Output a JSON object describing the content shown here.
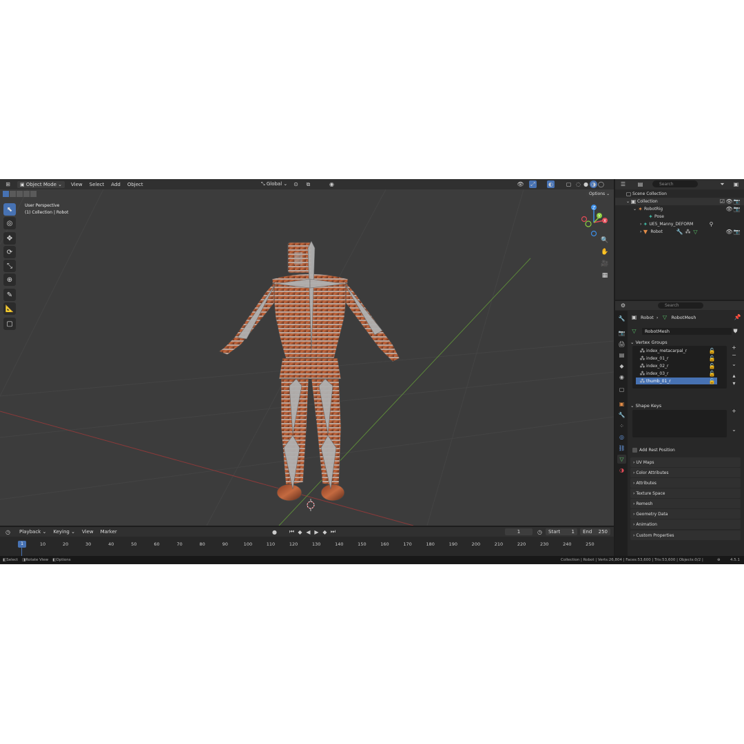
{
  "viewport_header": {
    "mode": "Object Mode",
    "menus": [
      "View",
      "Select",
      "Add",
      "Object"
    ],
    "orientation": "Global",
    "options": "Options"
  },
  "viewport": {
    "perspective": "User Perspective",
    "collection_label": "(1) Collection | Robot",
    "gizmo_axes": [
      "Z",
      "Y",
      "X"
    ]
  },
  "outliner": {
    "search_placeholder": "Search",
    "rows": [
      {
        "label": "Scene Collection"
      },
      {
        "label": "Collection"
      },
      {
        "label": "RobotRig"
      },
      {
        "label": "Pose"
      },
      {
        "label": "UE5_Manny_DEFORM"
      },
      {
        "label": "Robot"
      }
    ]
  },
  "properties": {
    "search_placeholder": "Search",
    "breadcrumb_object": "Robot",
    "breadcrumb_data": "RobotMesh",
    "mesh_name": "RobotMesh",
    "vertex_groups_title": "Vertex Groups",
    "vertex_groups": [
      "index_metacarpal_r",
      "index_01_r",
      "index_02_r",
      "index_03_r",
      "thumb_01_r"
    ],
    "shape_keys_title": "Shape Keys",
    "add_rest_position": "Add Rest Position",
    "panels": [
      "UV Maps",
      "Color Attributes",
      "Attributes",
      "Texture Space",
      "Remesh",
      "Geometry Data",
      "Animation",
      "Custom Properties"
    ]
  },
  "timeline": {
    "menus": [
      "Playback",
      "Keying",
      "View",
      "Marker"
    ],
    "current_frame": "1",
    "start_label": "Start",
    "start": "1",
    "end_label": "End",
    "end": "250",
    "playhead": "1",
    "ticks": [
      "10",
      "20",
      "30",
      "40",
      "50",
      "60",
      "70",
      "80",
      "90",
      "100",
      "110",
      "120",
      "130",
      "140",
      "150",
      "160",
      "170",
      "180",
      "190",
      "200",
      "210",
      "220",
      "230",
      "240",
      "250"
    ]
  },
  "status": {
    "select": "Select",
    "rotate": "Rotate View",
    "options": "Options",
    "stats": "Collection | Robot | Verts:26,804 | Faces:53,600 | Tris:53,600 | Objects:0/2 |",
    "version": "4.5.1"
  },
  "colors": {
    "accent": "#4772b3",
    "x_axis": "#e14b57",
    "y_axis": "#8ccf3f",
    "z_axis": "#3d8ee6"
  }
}
